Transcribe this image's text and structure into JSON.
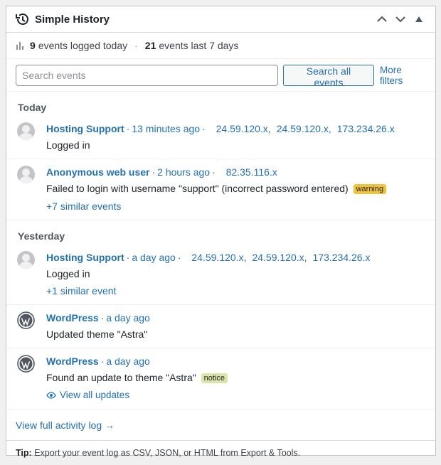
{
  "header": {
    "title": "Simple History"
  },
  "stats": {
    "today_count": "9",
    "today_label": "events logged today",
    "week_count": "21",
    "week_label": "events last 7 days",
    "separator": "·"
  },
  "search": {
    "placeholder": "Search events",
    "button_label": "Search all events",
    "more_filters": "More filters"
  },
  "groups": {
    "today": "Today",
    "yesterday": "Yesterday"
  },
  "events": [
    {
      "who": "Hosting Support",
      "time": "13 minutes ago",
      "ips": [
        "24.59.120.x",
        "24.59.120.x",
        "173.234.26.x"
      ],
      "message": "Logged in"
    },
    {
      "who": "Anonymous web user",
      "time": "2 hours ago",
      "ips": [
        "82.35.116.x"
      ],
      "message": "Failed to login with username \"support\" (incorrect password entered)",
      "badge": "warning",
      "similar": "+7 similar events"
    },
    {
      "who": "Hosting Support",
      "time": "a day ago",
      "ips": [
        "24.59.120.x",
        "24.59.120.x",
        "173.234.26.x"
      ],
      "message": "Logged in",
      "similar": "+1 similar event"
    },
    {
      "who": "WordPress",
      "time": "a day ago",
      "message": "Updated theme \"Astra\""
    },
    {
      "who": "WordPress",
      "time": "a day ago",
      "message": "Found an update to theme \"Astra\"",
      "badge": "notice",
      "link": "View all updates"
    }
  ],
  "footer": {
    "full_log": "View full activity log →",
    "tip_label": "Tip:",
    "tip_text": "Export your event log as CSV, JSON, or HTML from Export & Tools."
  },
  "colors": {
    "link": "#2271b1",
    "warning": "#f0c33c",
    "notice": "#dbe4a9"
  }
}
